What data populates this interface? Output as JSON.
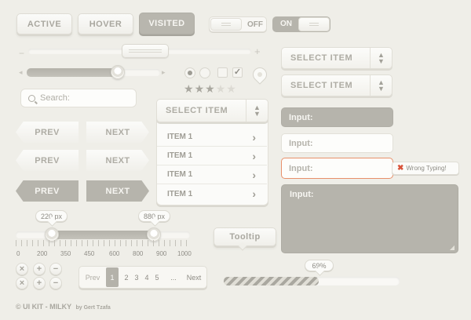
{
  "buttons": {
    "active": "ACTIVE",
    "hover": "HOVER",
    "visited": "VISITED"
  },
  "toggles": {
    "off_label": "OFF",
    "on_label": "ON"
  },
  "search": {
    "placeholder": "Search:"
  },
  "nav_buttons": {
    "prev": "PREV",
    "next": "NEXT"
  },
  "dropdown": {
    "label": "SELECT ITEM",
    "items": [
      "ITEM 1",
      "ITEM 1",
      "ITEM 1",
      "ITEM 1"
    ]
  },
  "selects": [
    {
      "label": "SELECT ITEM"
    },
    {
      "label": "SELECT ITEM"
    }
  ],
  "inputs": {
    "filled_label": "Input:",
    "plain_label": "Input:",
    "error_label": "Input:",
    "error_message": "Wrong Typing!",
    "textarea_label": "Input:"
  },
  "range_slider": {
    "low_value": "220 px",
    "high_value": "880 px",
    "ticks": [
      "0",
      "200",
      "350",
      "450",
      "600",
      "800",
      "900",
      "1000"
    ]
  },
  "tooltip": {
    "label": "Tooltip"
  },
  "rating": {
    "filled": 3,
    "total": 5
  },
  "pagination": {
    "prev": "Prev",
    "pages": [
      "1",
      "2",
      "3",
      "4",
      "5",
      "..."
    ],
    "active_page": "1",
    "next": "Next"
  },
  "progress": {
    "label": "69%",
    "value": 0.69
  },
  "footer": {
    "credit": "© UI KIT - MILKY",
    "author": "by Gert Tzafa"
  },
  "colors": {
    "background": "#efeee8",
    "dark_button": "#b8b6ae",
    "error_border": "#e8906a",
    "error_icon": "#d9533a"
  }
}
